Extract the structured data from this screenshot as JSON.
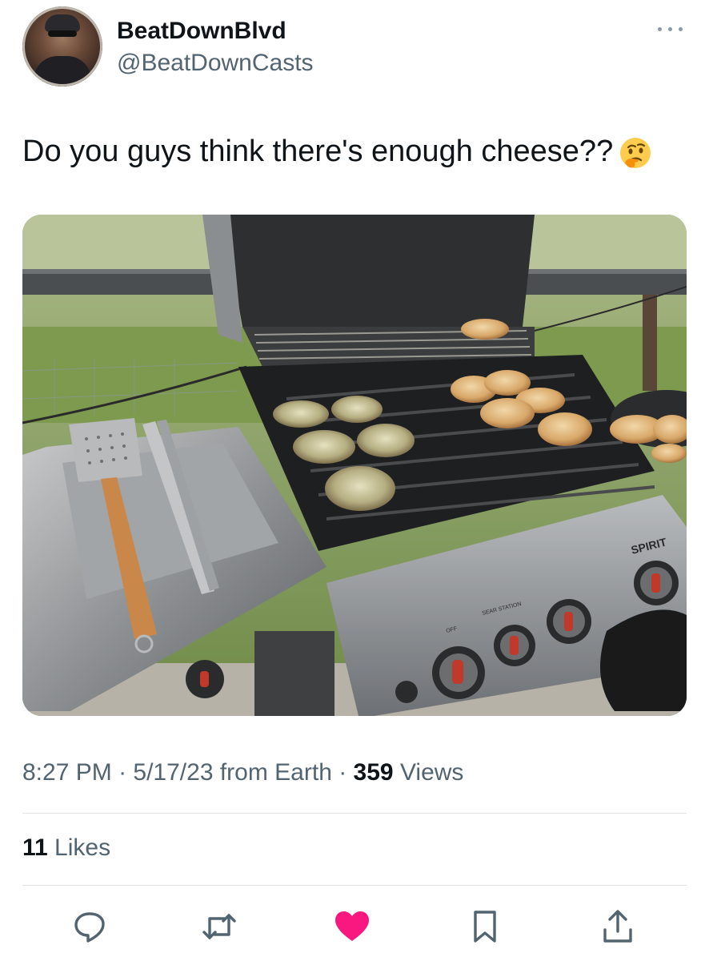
{
  "author": {
    "display_name": "BeatDownBlvd",
    "handle": "@BeatDownCasts",
    "avatar_icon": "user-avatar"
  },
  "menu_icon": "more-dots-icon",
  "tweet": {
    "text": "Do you guys think there's enough cheese??",
    "emoji_icon": "thinking-face-emoji"
  },
  "photo": {
    "subject": "grill-photo",
    "grill_brand": "SPIRIT",
    "knob_label_station": "SEAR STATION",
    "knob_label_off": "OFF"
  },
  "meta": {
    "time": "8:27 PM",
    "sep1": " · ",
    "date": "5/17/23",
    "source": " from Earth",
    "sep2": " · ",
    "views_count": "359",
    "views_label": " Views"
  },
  "stats": {
    "likes_count": "11",
    "likes_label": " Likes"
  },
  "actions": [
    {
      "name": "reply-icon"
    },
    {
      "name": "retweet-icon"
    },
    {
      "name": "like-icon",
      "color": "#f91880"
    },
    {
      "name": "bookmark-icon"
    },
    {
      "name": "share-icon"
    }
  ],
  "colors": {
    "text_primary": "#0f1419",
    "text_secondary": "#536471",
    "icon": "#536471",
    "like": "#f91880",
    "divider": "#e1e4e7"
  }
}
